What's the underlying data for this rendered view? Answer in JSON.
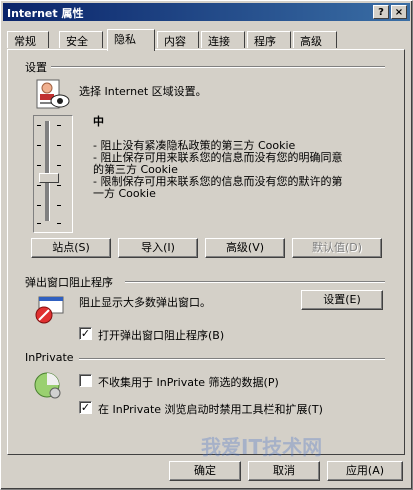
{
  "window": {
    "title": "Internet 属性",
    "help_btn": "?",
    "close_btn": "×"
  },
  "tabs": [
    "常规",
    "安全",
    "隐私",
    "内容",
    "连接",
    "程序",
    "高级"
  ],
  "settings": {
    "group_label": "设置",
    "instruction": "选择 Internet 区域设置。",
    "level": "中",
    "desc": [
      "- 阻止没有紧凑隐私政策的第三方 Cookie",
      "- 阻止保存可用来联系您的信息而没有您的明确同意",
      "  的第三方 Cookie",
      "- 限制保存可用来联系您的信息而没有您的默许的第",
      "  一方 Cookie"
    ],
    "buttons": [
      "站点(S)",
      "导入(I)",
      "高级(V)",
      "默认值(D)"
    ]
  },
  "popup": {
    "group_label": "弹出窗口阻止程序",
    "text": "阻止显示大多数弹出窗口。",
    "settings_btn": "设置(E)",
    "checkbox": "打开弹出窗口阻止程序(B)",
    "checked": true
  },
  "inprivate": {
    "group_label": "InPrivate",
    "opt1": "不收集用于 InPrivate 筛选的数据(P)",
    "opt1_checked": false,
    "opt2": "在 InPrivate 浏览启动时禁用工具栏和扩展(T)",
    "opt2_checked": true
  },
  "footer": {
    "ok": "确定",
    "cancel": "取消",
    "apply": "应用(A)"
  },
  "watermark": "我爱IT技术网"
}
